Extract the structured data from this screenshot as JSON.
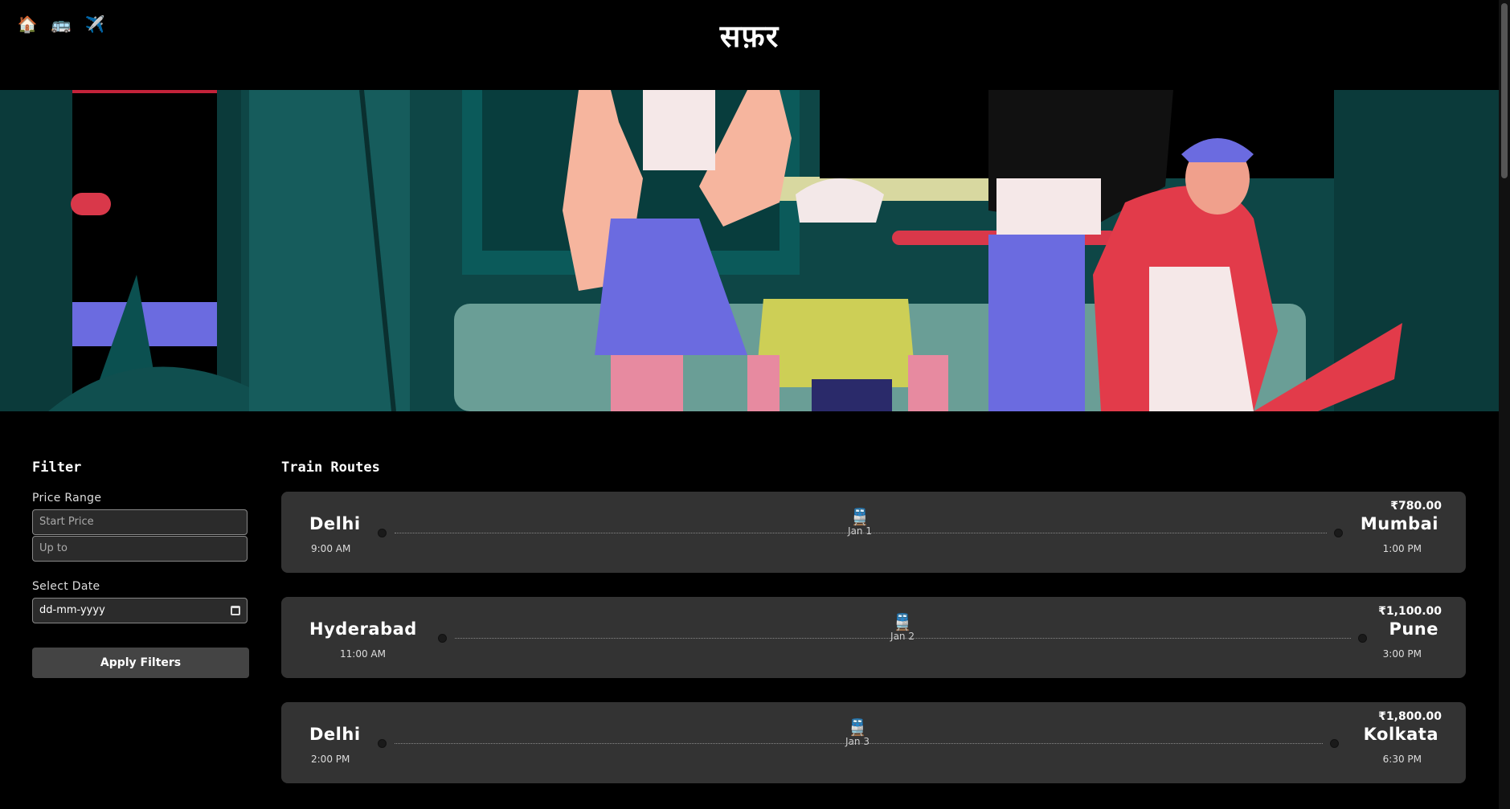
{
  "nav": {
    "icons": [
      {
        "name": "home-icon",
        "glyph": "🏠"
      },
      {
        "name": "bus-icon",
        "glyph": "🚌"
      },
      {
        "name": "airplane-icon",
        "glyph": "✈️"
      }
    ],
    "brand": "सफ़र"
  },
  "filter": {
    "title": "Filter",
    "price_label": "Price Range",
    "start_placeholder": "Start Price",
    "upto_placeholder": "Up to",
    "date_label": "Select Date",
    "date_value": "dd-mm-yyyy",
    "apply_label": "Apply Filters"
  },
  "routes": {
    "title": "Train Routes",
    "items": [
      {
        "from": "Delhi",
        "from_time": "9:00 AM",
        "to": "Mumbai",
        "to_time": "1:00 PM",
        "date": "Jan 1",
        "price": "₹780.00",
        "icon": "🚆"
      },
      {
        "from": "Hyderabad",
        "from_time": "11:00 AM",
        "to": "Pune",
        "to_time": "3:00 PM",
        "date": "Jan 2",
        "price": "₹1,100.00",
        "icon": "🚆"
      },
      {
        "from": "Delhi",
        "from_time": "2:00 PM",
        "to": "Kolkata",
        "to_time": "6:30 PM",
        "date": "Jan 3",
        "price": "₹1,800.00",
        "icon": "🚆"
      }
    ]
  }
}
